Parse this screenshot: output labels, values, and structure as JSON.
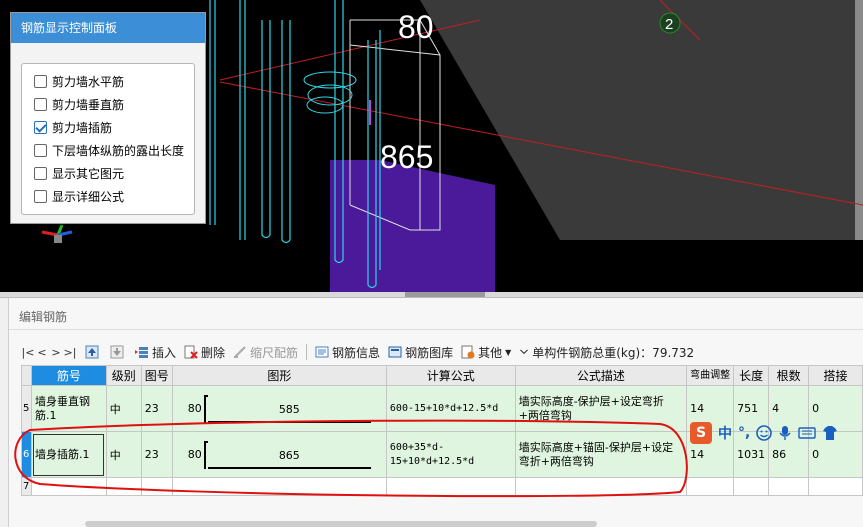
{
  "viewport": {
    "label_80": "80",
    "label_865": "865",
    "marker_2": "2"
  },
  "control_panel": {
    "title": "钢筋显示控制面板",
    "options": [
      {
        "label": "剪力墙水平筋",
        "checked": false
      },
      {
        "label": "剪力墙垂直筋",
        "checked": false
      },
      {
        "label": "剪力墙插筋",
        "checked": true
      },
      {
        "label": "下层墙体纵筋的露出长度",
        "checked": false
      },
      {
        "label": "显示其它图元",
        "checked": false
      },
      {
        "label": "显示详细公式",
        "checked": false
      }
    ]
  },
  "edit_panel": {
    "title": "编辑钢筋"
  },
  "toolbar": {
    "nav": [
      "|<",
      "<",
      ">",
      ">|"
    ],
    "insert": "插入",
    "delete": "删除",
    "scale_rebar": "缩尺配筋",
    "rebar_info": "钢筋信息",
    "rebar_library": "钢筋图库",
    "other": "其他",
    "total_weight": "单构件钢筋总重(kg)：79.732"
  },
  "table": {
    "headers": [
      "筋号",
      "级别",
      "图号",
      "图形",
      "计算公式",
      "公式描述",
      "弯曲调整",
      "长度",
      "根数",
      "搭接"
    ],
    "rows": [
      {
        "row_no": "5",
        "name": "墙身垂直钢筋.1",
        "grade": "中",
        "fig_no": "23",
        "fig_left": "80",
        "fig_value": "585",
        "formula": "600-15+10*d+12.5*d",
        "desc": "墙实际高度-保护层+设定弯折+两倍弯钩",
        "bend": "14",
        "length": "751",
        "count": "4",
        "lap": "0"
      },
      {
        "row_no": "6",
        "name": "墙身插筋.1",
        "grade": "中",
        "fig_no": "23",
        "fig_left": "80",
        "fig_value": "865",
        "formula": "600+35*d-15+10*d+12.5*d",
        "desc": "墙实际高度+锚固-保护层+设定弯折+两倍弯钩",
        "bend": "14",
        "length": "1031",
        "count": "86",
        "lap": "0"
      }
    ],
    "empty_row_no": "7"
  },
  "ime": {
    "logo": "S",
    "lang": "中",
    "punct": "°,"
  }
}
